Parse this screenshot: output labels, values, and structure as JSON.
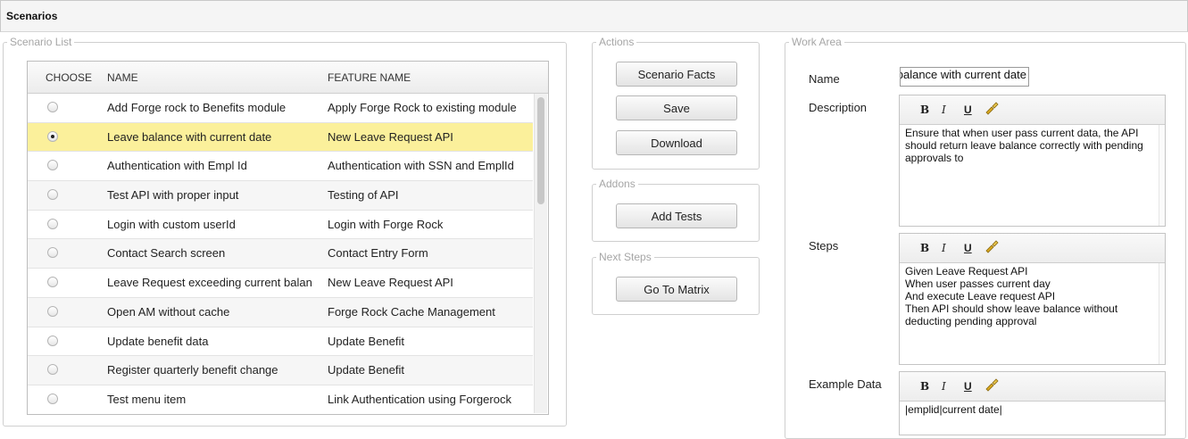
{
  "window": {
    "title": "Scenarios"
  },
  "scenario_list": {
    "legend": "Scenario List",
    "columns": {
      "choose": "CHOOSE",
      "name": "NAME",
      "feature": "FEATURE NAME"
    },
    "rows": [
      {
        "name": "Add Forge rock to Benefits module",
        "feature": "Apply Forge Rock to existing module",
        "selected": false
      },
      {
        "name": "Leave balance with current date",
        "feature": "New Leave Request API",
        "selected": true
      },
      {
        "name": "Authentication with Empl Id",
        "feature": "Authentication with SSN and EmplId",
        "selected": false
      },
      {
        "name": "Test API with proper input",
        "feature": "Testing of API",
        "selected": false
      },
      {
        "name": "Login with custom userId",
        "feature": "Login with Forge Rock",
        "selected": false
      },
      {
        "name": "Contact Search screen",
        "feature": "Contact Entry Form",
        "selected": false
      },
      {
        "name": "Leave Request exceeding current balan",
        "feature": "New Leave Request API",
        "selected": false
      },
      {
        "name": "Open AM without cache",
        "feature": "Forge Rock Cache Management",
        "selected": false
      },
      {
        "name": "Update benefit data",
        "feature": "Update Benefit",
        "selected": false
      },
      {
        "name": "Register quarterly benefit change",
        "feature": "Update Benefit",
        "selected": false
      },
      {
        "name": "Test menu item",
        "feature": "Link Authentication using Forgerock",
        "selected": false
      }
    ]
  },
  "actions": {
    "legend": "Actions",
    "scenario_facts": "Scenario Facts",
    "save": "Save",
    "download": "Download"
  },
  "addons": {
    "legend": "Addons",
    "add_tests": "Add Tests"
  },
  "next_steps": {
    "legend": "Next Steps",
    "go_to_matrix": "Go To Matrix"
  },
  "work_area": {
    "legend": "Work Area",
    "name_label": "Name",
    "name_value": "Leave balance with current date",
    "description_label": "Description",
    "description_lines": [
      "Ensure that when user pass current data, the API",
      "should return leave balance correctly with pending",
      "approvals to"
    ],
    "steps_label": "Steps",
    "steps_lines": [
      "Given Leave Request API",
      "When user passes current day",
      "And execute Leave request API",
      "Then API should show leave balance without",
      "deducting pending approval"
    ],
    "example_label": "Example Data",
    "example_lines": [
      "|emplid|current date|"
    ],
    "toolbar": {
      "bold": "B",
      "italic": "I",
      "underline": "U",
      "format_brush": "🧹"
    }
  }
}
